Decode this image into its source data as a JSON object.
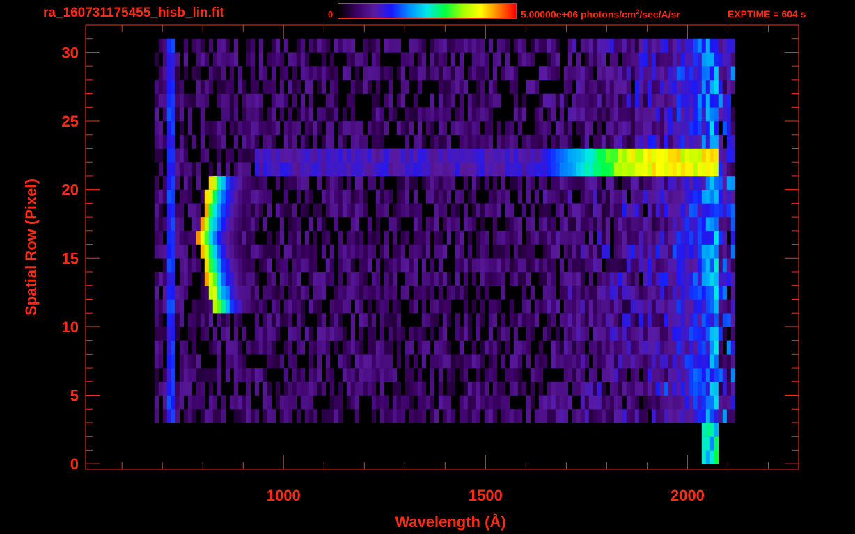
{
  "header": {
    "filename": "ra_160731175455_hisb_lin.fit",
    "colorbar_min_label": "0",
    "colorbar_max_label_prefix": "5.00000e+06 photons/cm",
    "colorbar_max_label_sup": "2",
    "colorbar_max_label_suffix": "/sec/A/sr",
    "exptime_label": "EXPTIME = 604 s"
  },
  "colors": {
    "text": "#ff2a14",
    "axes": "#ff2a14",
    "background": "#000000",
    "colormap": [
      "#000000",
      "#3a0060",
      "#5a1aa0",
      "#1818ff",
      "#0090ff",
      "#00e8e8",
      "#00ff40",
      "#a0ff00",
      "#ffff00",
      "#ff8000",
      "#ff0000"
    ]
  },
  "chart_data": {
    "type": "heatmap",
    "xlabel": "Wavelength (Å)",
    "ylabel": "Spatial Row (Pixel)",
    "xlim": [
      510,
      2275
    ],
    "ylim": [
      -0.4,
      32
    ],
    "x_ticks": [
      1000,
      1500,
      2000
    ],
    "y_ticks": [
      0,
      5,
      10,
      15,
      20,
      25,
      30
    ],
    "colorbar_range": [
      0,
      5000000
    ],
    "features": [
      {
        "label_text": "",
        "wavelength_range": [
          780,
          900
        ],
        "rows": [
          11,
          20
        ],
        "peak_row": 16,
        "peak_wavelength": 790,
        "level": 1.0
      },
      {
        "label_text": "",
        "wavelength_range": [
          920,
          2075
        ],
        "rows": [
          21,
          22
        ],
        "peak_wavelength": 1830,
        "level": 0.55
      },
      {
        "label_text": "",
        "wavelength_range": [
          1880,
          2075
        ],
        "rows": [
          3,
          30
        ],
        "level": 0.45
      },
      {
        "label_text": "",
        "wavelength_range": [
          680,
          2110
        ],
        "rows": [
          3,
          30
        ],
        "level": 0.12
      }
    ]
  }
}
